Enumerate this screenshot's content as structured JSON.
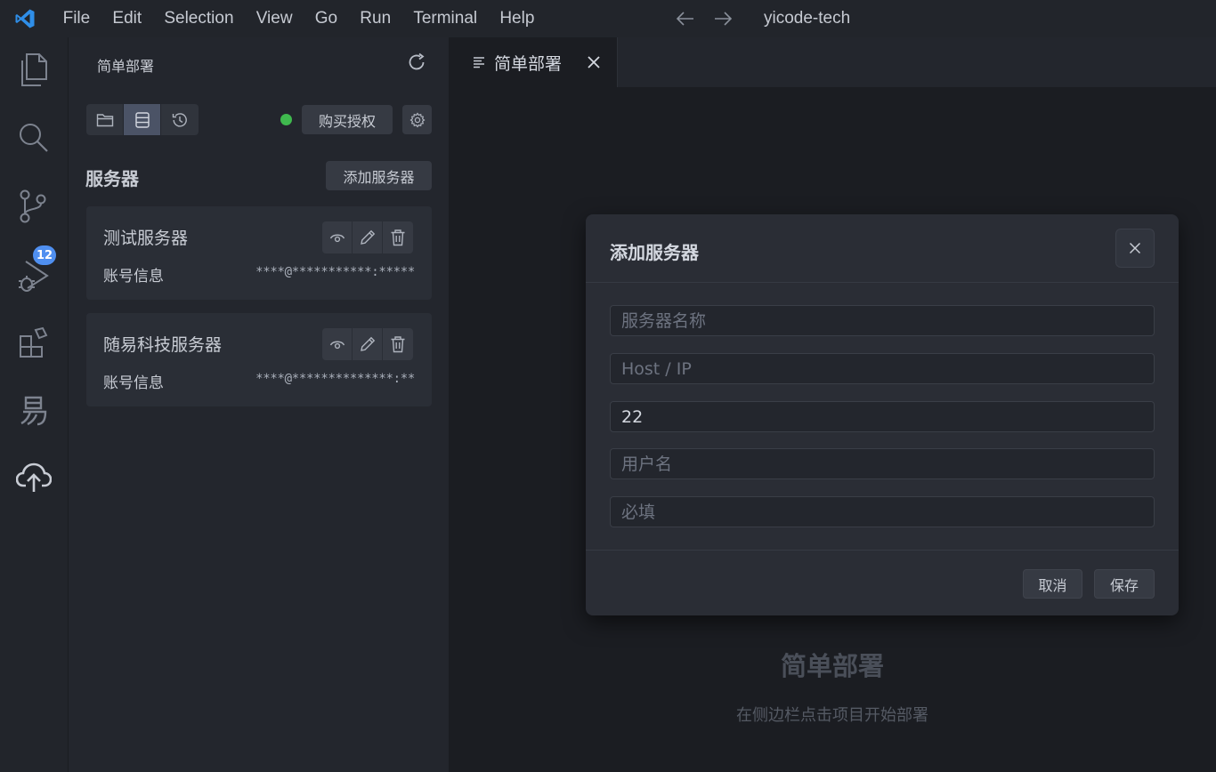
{
  "titlebar": {
    "menu": [
      "File",
      "Edit",
      "Selection",
      "View",
      "Go",
      "Run",
      "Terminal",
      "Help"
    ],
    "window_title": "yicode-tech"
  },
  "activitybar": {
    "icons": [
      "explorer-icon",
      "search-icon",
      "source-control-icon",
      "run-debug-icon",
      "extensions-icon",
      "yi-icon",
      "cloud-upload-icon"
    ],
    "source_control_badge": "12"
  },
  "sidebar": {
    "title": "简单部署",
    "buy_license_label": "购买授权",
    "status_color": "#3fb94e",
    "section_title": "服务器",
    "add_server_label": "添加服务器",
    "servers": [
      {
        "name": "测试服务器",
        "account_label": "账号信息",
        "account_value": "****@***********:*****"
      },
      {
        "name": "随易科技服务器",
        "account_label": "账号信息",
        "account_value": "****@**************:**"
      }
    ]
  },
  "editor": {
    "tab_label": "简单部署",
    "welcome_title": "简单部署",
    "welcome_subtitle": "在侧边栏点击项目开始部署"
  },
  "modal": {
    "title": "添加服务器",
    "fields": {
      "name_placeholder": "服务器名称",
      "host_placeholder": "Host / IP",
      "port_value": "22",
      "user_placeholder": "用户名",
      "password_placeholder": "必填"
    },
    "cancel_label": "取消",
    "save_label": "保存"
  }
}
